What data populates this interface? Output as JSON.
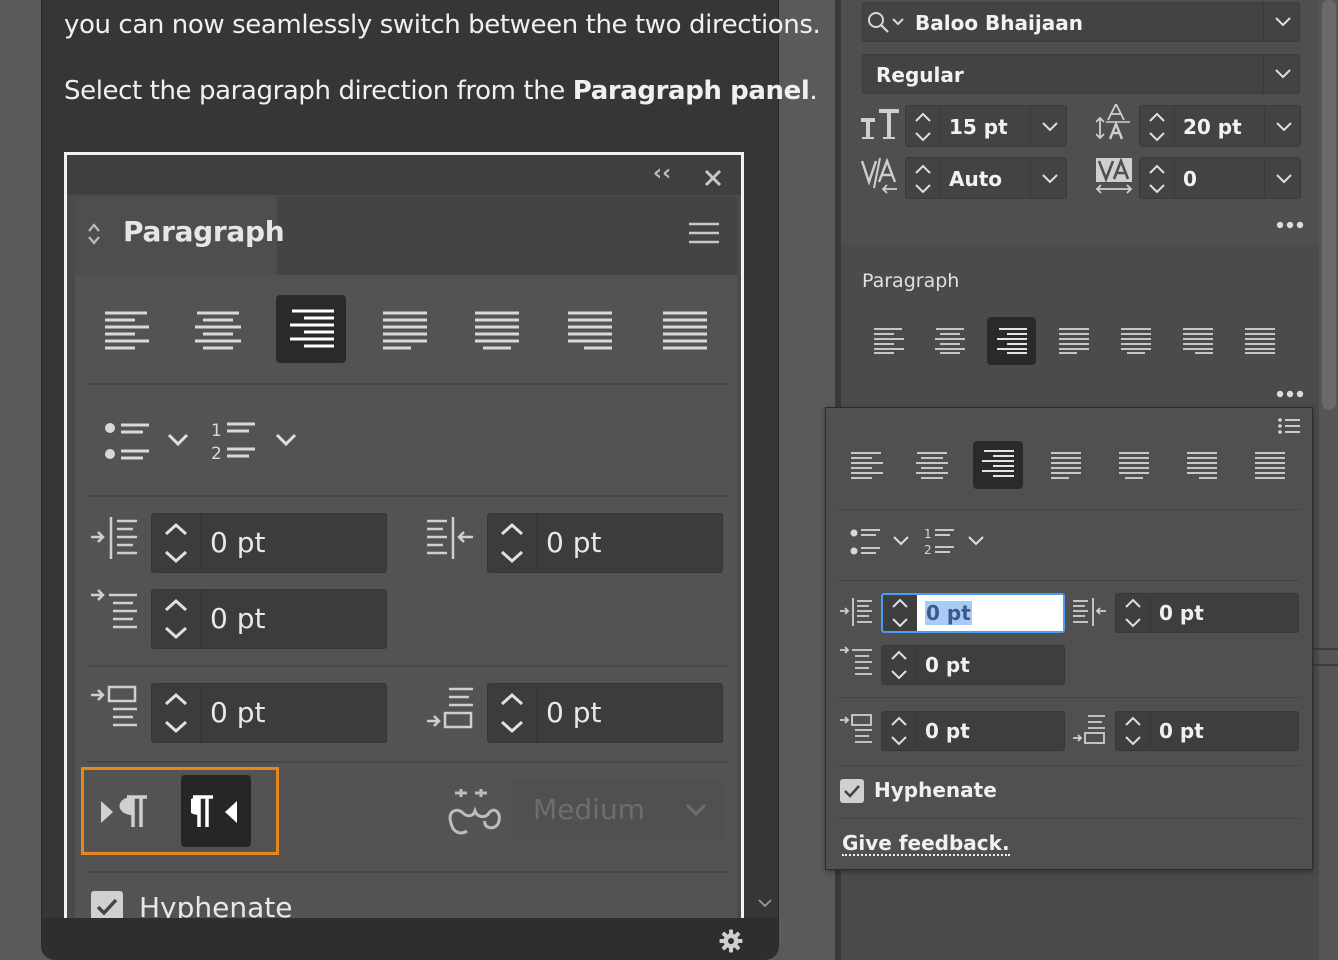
{
  "help_card": {
    "line1": "you can now seamlessly switch between the two directions.",
    "line2_prefix": "Select the paragraph direction from the ",
    "line2_bold": "Paragraph panel",
    "line2_suffix": ".",
    "screenshot": {
      "panel_title": "Paragraph",
      "indent_left": "0 pt",
      "indent_right": "0 pt",
      "indent_first": "0 pt",
      "space_before": "0 pt",
      "space_after": "0 pt",
      "kashida_value": "Medium",
      "hyphenate_label": "Hyphenate"
    }
  },
  "character": {
    "font_family": "Baloo Bhaijaan",
    "font_style": "Regular",
    "font_size": "15 pt",
    "leading": "20 pt",
    "kerning": "Auto",
    "tracking": "0"
  },
  "paragraph_section": {
    "title": "Paragraph"
  },
  "popup": {
    "indent_left": "0 pt",
    "indent_right": "0 pt",
    "indent_first": "0 pt",
    "space_before": "0 pt",
    "space_after": "0 pt",
    "hyphenate_label": "Hyphenate",
    "feedback_link": "Give feedback."
  },
  "colors": {
    "highlight": "#e8861a",
    "focus": "#4b9cf5",
    "selection": "#a9cbf5"
  }
}
